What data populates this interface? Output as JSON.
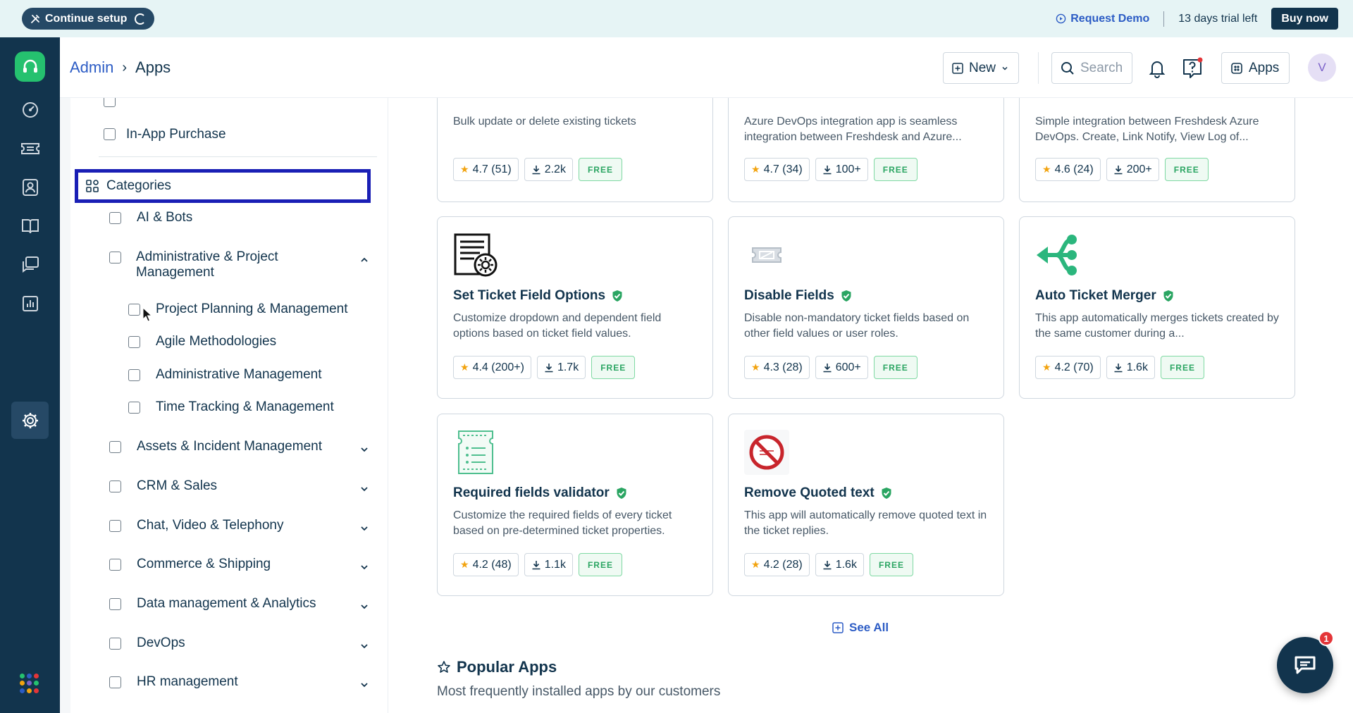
{
  "banner": {
    "setup_label": "Continue setup",
    "request_demo": "Request Demo",
    "trial_text": "13 days trial left",
    "buy_label": "Buy now"
  },
  "header": {
    "breadcrumb_root": "Admin",
    "breadcrumb_current": "Apps",
    "new_label": "New",
    "search_placeholder": "Search",
    "apps_label": "Apps",
    "avatar_initial": "V"
  },
  "sidebar": {
    "filters_above": [
      {
        "label": "In-App Purchase",
        "checked": false
      }
    ],
    "categories_title": "Categories",
    "categories": [
      {
        "label": "AI & Bots",
        "expandable": false
      },
      {
        "label": "Administrative & Project Management",
        "expandable": true,
        "expanded": true,
        "children": [
          "Project Planning & Management",
          "Agile Methodologies",
          "Administrative Management",
          "Time Tracking & Management"
        ]
      },
      {
        "label": "Assets & Incident Management",
        "expandable": true,
        "expanded": false
      },
      {
        "label": "CRM & Sales",
        "expandable": true,
        "expanded": false
      },
      {
        "label": "Chat, Video & Telephony",
        "expandable": true,
        "expanded": false
      },
      {
        "label": "Commerce & Shipping",
        "expandable": true,
        "expanded": false
      },
      {
        "label": "Data management & Analytics",
        "expandable": true,
        "expanded": false
      },
      {
        "label": "DevOps",
        "expandable": true,
        "expanded": false
      },
      {
        "label": "HR management",
        "expandable": true,
        "expanded": false
      }
    ]
  },
  "apps": [
    {
      "title": "",
      "description": "Bulk update or delete existing tickets",
      "rating": "4.7 (51)",
      "installs": "2.2k",
      "price": "FREE"
    },
    {
      "title": "",
      "description": "Azure DevOps integration app is seamless integration between Freshdesk and Azure...",
      "rating": "4.7 (34)",
      "installs": "100+",
      "price": "FREE"
    },
    {
      "title": "",
      "description": "Simple integration between Freshdesk Azure DevOps. Create, Link Notify, View Log of...",
      "rating": "4.6 (24)",
      "installs": "200+",
      "price": "FREE"
    },
    {
      "title": "Set Ticket Field Options",
      "description": "Customize dropdown and dependent field options based on ticket field values.",
      "rating": "4.4 (200+)",
      "installs": "1.7k",
      "price": "FREE",
      "icon": "ticket-settings-icon"
    },
    {
      "title": "Disable Fields",
      "description": "Disable non-mandatory ticket fields based on other field values or user roles.",
      "rating": "4.3 (28)",
      "installs": "600+",
      "price": "FREE",
      "icon": "disabled-ticket-icon"
    },
    {
      "title": "Auto Ticket Merger",
      "description": "This app automatically merges tickets created by the same customer during a...",
      "rating": "4.2 (70)",
      "installs": "1.6k",
      "price": "FREE",
      "icon": "merge-arrows-icon"
    },
    {
      "title": "Required fields validator",
      "description": "Customize the required fields of every ticket based on pre-determined ticket properties.",
      "rating": "4.2 (48)",
      "installs": "1.1k",
      "price": "FREE",
      "icon": "checklist-ticket-icon"
    },
    {
      "title": "Remove Quoted text",
      "description": "This app will automatically remove quoted text in the ticket replies.",
      "rating": "4.2 (28)",
      "installs": "1.6k",
      "price": "FREE",
      "icon": "no-quoted-text-icon"
    }
  ],
  "see_all": "See All",
  "popular": {
    "title": "Popular Apps",
    "subtitle": "Most frequently installed apps by our customers"
  },
  "chat": {
    "badge": "1"
  },
  "colors": {
    "brand_navy": "#12344d",
    "link_blue": "#2c5cc5",
    "free_green": "#2aa562",
    "highlight_border": "#1a1fb5",
    "logo_green": "#25c16f"
  }
}
